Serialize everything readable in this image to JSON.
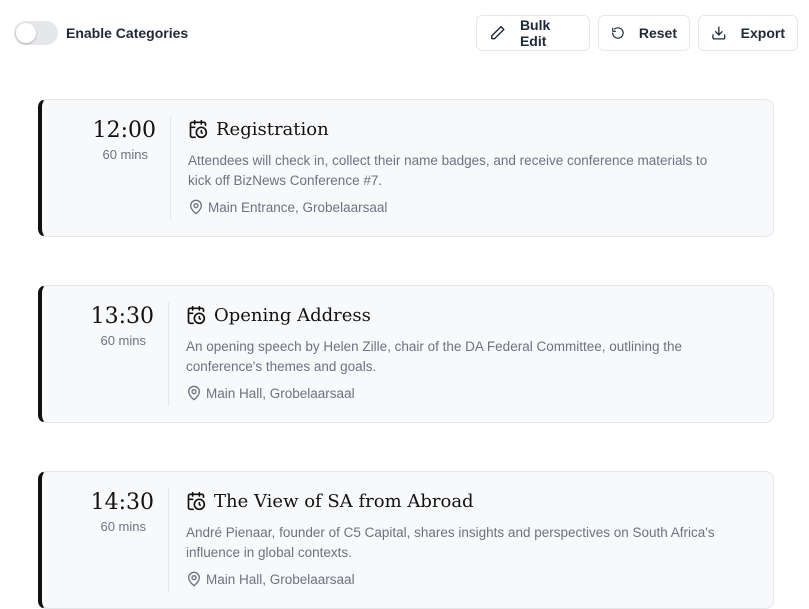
{
  "toolbar": {
    "toggle_label": "Enable Categories",
    "toggle_on": false,
    "bulk_edit_label": "Bulk Edit",
    "reset_label": "Reset",
    "export_label": "Export"
  },
  "sessions": [
    {
      "time": "12:00",
      "duration": "60 mins",
      "title": "Registration",
      "description": "Attendees will check in, collect their name badges, and receive conference materials to kick off BizNews Conference #7.",
      "location": "Main Entrance, Grobelaarsaal"
    },
    {
      "time": "13:30",
      "duration": "60 mins",
      "title": "Opening Address",
      "description": "An opening speech by Helen Zille, chair of the DA Federal Committee, outlining the conference's themes and goals.",
      "location": "Main Hall, Grobelaarsaal"
    },
    {
      "time": "14:30",
      "duration": "60 mins",
      "title": "The View of SA from Abroad",
      "description": "André Pienaar, founder of C5 Capital, shares insights and perspectives on South Africa's influence in global contexts.",
      "location": "Main Hall, Grobelaarsaal"
    }
  ],
  "colors": {
    "accent_border": "#111111",
    "card_background": "#f8f9fb",
    "muted_text": "#6b7280"
  }
}
